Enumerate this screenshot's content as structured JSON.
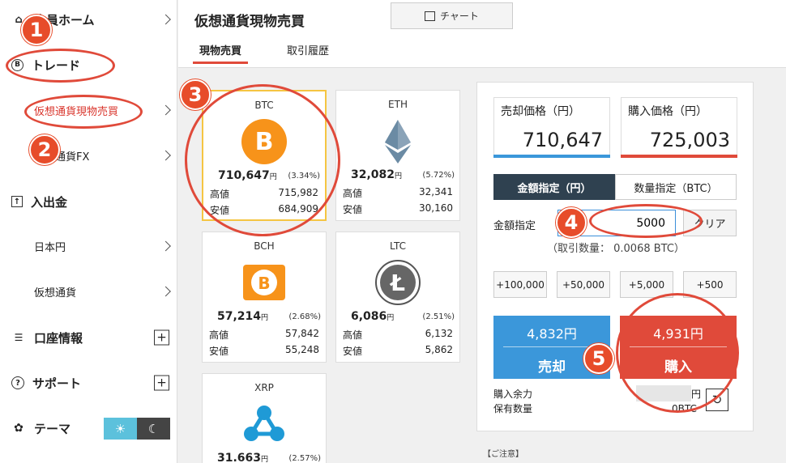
{
  "sidebar": {
    "home": "会員ホーム",
    "trade": "トレード",
    "spot": "仮想通貨現物売買",
    "fx": "仮想通貨FX",
    "deposit": "入出金",
    "jpy": "日本円",
    "crypto": "仮想通貨",
    "account": "口座情報",
    "support": "サポート",
    "theme": "テーマ"
  },
  "header": {
    "title": "仮想通貨現物売買",
    "chart_button": "チャート",
    "tabs": [
      "現物売買",
      "取引履歴"
    ]
  },
  "coins": [
    {
      "symbol": "BTC",
      "price": "710,647",
      "unit": "円",
      "change": "(3.34%)",
      "high_label": "高値",
      "high": "715,982",
      "low_label": "安値",
      "low": "684,909",
      "color": "#f7931a"
    },
    {
      "symbol": "ETH",
      "price": "32,082",
      "unit": "円",
      "change": "(5.72%)",
      "high_label": "高値",
      "high": "32,341",
      "low_label": "安値",
      "low": "30,160",
      "color": "#6b8ba4"
    },
    {
      "symbol": "BCH",
      "price": "57,214",
      "unit": "円",
      "change": "(2.68%)",
      "high_label": "高値",
      "high": "57,842",
      "low_label": "安値",
      "low": "55,248",
      "color": "#f7931a"
    },
    {
      "symbol": "LTC",
      "price": "6,086",
      "unit": "円",
      "change": "(2.51%)",
      "high_label": "高値",
      "high": "6,132",
      "low_label": "安値",
      "low": "5,862",
      "color": "#555555"
    },
    {
      "symbol": "XRP",
      "price": "31.663",
      "unit": "円",
      "change": "(2.57%)",
      "color": "#1f9ad6"
    }
  ],
  "order": {
    "sell_label": "売却価格（円）",
    "sell_price": "710,647",
    "buy_label": "購入価格（円）",
    "buy_price": "725,003",
    "mode_yen": "金額指定（円）",
    "mode_btc": "数量指定（BTC）",
    "amount_label": "金額指定",
    "amount_value": "5000",
    "clear": "クリア",
    "estimate": "（取引数量： 0.0068 BTC）",
    "increments": [
      "+100,000",
      "+50,000",
      "+5,000",
      "+500"
    ],
    "sell_amount": "4,832円",
    "sell_action": "売却",
    "buy_amount": "4,931円",
    "buy_action": "購入",
    "balance_label": "購入余力",
    "balance_unit": "円",
    "holding_label": "保有数量",
    "holding_unit": "0BTC",
    "notes": "【ご注意】"
  },
  "annotations": [
    "1",
    "2",
    "3",
    "4",
    "5"
  ],
  "colors": {
    "accent": "#e04a3a",
    "sell": "#3b97da",
    "buy": "#e04a3a",
    "sell_bar": "#3b97da",
    "buy_bar": "#e04a3a"
  }
}
